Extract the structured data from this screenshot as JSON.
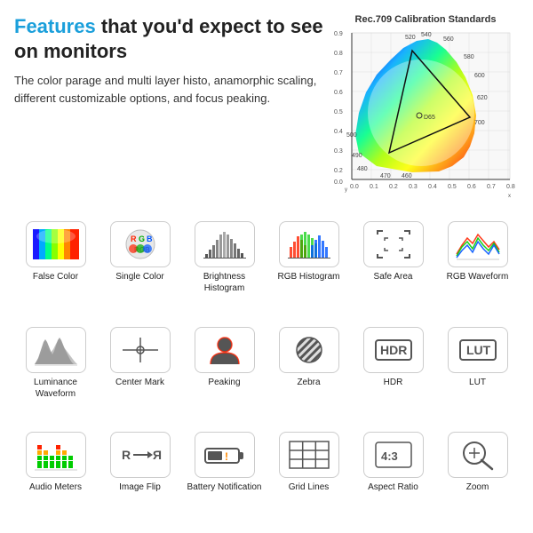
{
  "headline": {
    "prefix": "Features",
    "suffix": " that you'd expect to see on monitors"
  },
  "description": "The color parage and multi layer histo, anamorphic scaling, different customizable options, and focus peaking.",
  "chart": {
    "title": "Rec.709 Calibration Standards"
  },
  "features": [
    {
      "id": "false-color",
      "label": "False Color",
      "icon": "false-color"
    },
    {
      "id": "single-color",
      "label": "Single Color",
      "icon": "single-color"
    },
    {
      "id": "brightness-histogram",
      "label": "Brightness Histogram",
      "icon": "brightness-histogram"
    },
    {
      "id": "rgb-histogram",
      "label": "RGB Histogram",
      "icon": "rgb-histogram"
    },
    {
      "id": "safe-area",
      "label": "Safe Area",
      "icon": "safe-area"
    },
    {
      "id": "rgb-waveform",
      "label": "RGB Waveform",
      "icon": "rgb-waveform"
    },
    {
      "id": "luminance-waveform",
      "label": "Luminance Waveform",
      "icon": "luminance-waveform"
    },
    {
      "id": "center-mark",
      "label": "Center Mark",
      "icon": "center-mark"
    },
    {
      "id": "peaking",
      "label": "Peaking",
      "icon": "peaking"
    },
    {
      "id": "zebra",
      "label": "Zebra",
      "icon": "zebra"
    },
    {
      "id": "hdr",
      "label": "HDR",
      "icon": "hdr"
    },
    {
      "id": "lut",
      "label": "LUT",
      "icon": "lut"
    },
    {
      "id": "audio-meters",
      "label": "Audio Meters",
      "icon": "audio-meters"
    },
    {
      "id": "image-flip",
      "label": "Image Flip",
      "icon": "image-flip"
    },
    {
      "id": "battery-notification",
      "label": "Battery Notification",
      "icon": "battery-notification"
    },
    {
      "id": "grid-lines",
      "label": "Grid Lines",
      "icon": "grid-lines"
    },
    {
      "id": "aspect-ratio",
      "label": "Aspect Ratio",
      "icon": "aspect-ratio"
    },
    {
      "id": "zoom",
      "label": "Zoom",
      "icon": "zoom"
    }
  ]
}
